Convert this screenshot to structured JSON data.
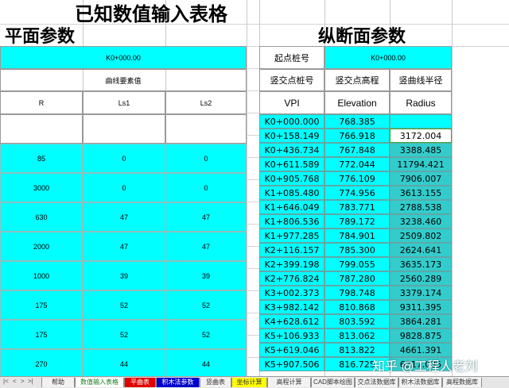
{
  "title": "已知数值输入表格",
  "left": {
    "section_title": "平面参数",
    "start_station": "K0+000.00",
    "curve_header": "曲线要素值",
    "columns": [
      "R",
      "Ls1",
      "Ls2"
    ],
    "rows": [
      [
        "85",
        "0",
        "0"
      ],
      [
        "3000",
        "0",
        "0"
      ],
      [
        "630",
        "47",
        "47"
      ],
      [
        "2000",
        "47",
        "47"
      ],
      [
        "1000",
        "39",
        "39"
      ],
      [
        "175",
        "52",
        "52"
      ],
      [
        "175",
        "52",
        "52"
      ],
      [
        "270",
        "44",
        "44"
      ]
    ]
  },
  "right": {
    "section_title": "纵断面参数",
    "start_label": "起点桩号",
    "start_value": "K0+000.00",
    "headers_cn": [
      "竖交点桩号",
      "竖交点高程",
      "竖曲线半径"
    ],
    "headers_en": [
      "VPI",
      "Elevation",
      "Radius"
    ],
    "rows": [
      [
        "K0+000.000",
        "768.385",
        ""
      ],
      [
        "K0+158.149",
        "766.918",
        "3172.004"
      ],
      [
        "K0+436.734",
        "767.848",
        "3388.485"
      ],
      [
        "K0+611.589",
        "772.044",
        "11794.421"
      ],
      [
        "K0+905.768",
        "776.109",
        "7906.007"
      ],
      [
        "K1+085.480",
        "774.956",
        "3613.155"
      ],
      [
        "K1+646.049",
        "783.771",
        "2788.538"
      ],
      [
        "K1+806.536",
        "789.172",
        "3238.460"
      ],
      [
        "K1+977.285",
        "784.901",
        "2509.802"
      ],
      [
        "K2+116.157",
        "785.300",
        "2624.641"
      ],
      [
        "K2+399.198",
        "799.055",
        "3635.173"
      ],
      [
        "K2+776.824",
        "787.280",
        "2560.289"
      ],
      [
        "K3+002.373",
        "798.748",
        "3379.174"
      ],
      [
        "K3+982.142",
        "810.868",
        "9311.395"
      ],
      [
        "K4+628.612",
        "803.592",
        "3864.281"
      ],
      [
        "K5+106.933",
        "813.062",
        "9828.875"
      ],
      [
        "K5+619.046",
        "813.822",
        "4661.391"
      ],
      [
        "K5+907.506",
        "816.725",
        "6317.035"
      ]
    ]
  },
  "tabs": [
    {
      "label": "帮助",
      "bg": "#f2f2f2",
      "fg": "#333333"
    },
    {
      "label": "数值输入表格",
      "bg": "#ffffff",
      "fg": "#1a7a1a"
    },
    {
      "label": "平曲表",
      "bg": "#e00000",
      "fg": "#ffffff"
    },
    {
      "label": "积木法参数",
      "bg": "#0000cc",
      "fg": "#ffffff"
    },
    {
      "label": "竖曲表",
      "bg": "#f2f2f2",
      "fg": "#333333"
    },
    {
      "label": "坐标计算",
      "bg": "#ffff00",
      "fg": "#333333"
    },
    {
      "label": "高程计算",
      "bg": "#f2f2f2",
      "fg": "#333333"
    },
    {
      "label": "CAD脚本绘图",
      "bg": "#f2f2f2",
      "fg": "#333333"
    },
    {
      "label": "交点法数据库",
      "bg": "#f2f2f2",
      "fg": "#333333"
    },
    {
      "label": "积木法数据库",
      "bg": "#f2f2f2",
      "fg": "#333333"
    },
    {
      "label": "高程数据库",
      "bg": "#f2f2f2",
      "fg": "#333333"
    }
  ],
  "nav": {
    "first": "|<",
    "prev": "<",
    "next": ">",
    "last": ">|"
  },
  "watermark": "知乎 @工程人老刘"
}
